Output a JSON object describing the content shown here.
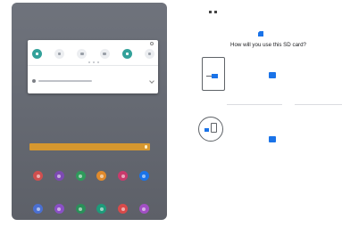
{
  "left_tablet": {
    "status_text": "",
    "quick_panel": {
      "time": "",
      "tiles": [
        {
          "name": "wifi-tile",
          "on": true
        },
        {
          "name": "sound-tile",
          "on": false
        },
        {
          "name": "rotate-tile",
          "on": false
        },
        {
          "name": "bluetooth-tile",
          "on": false
        },
        {
          "name": "lock-tile",
          "on": true
        },
        {
          "name": "airplane-tile",
          "on": false
        }
      ],
      "notification_title": "",
      "notification_text": ""
    },
    "search_label": "",
    "apps_row1": [
      "#cf4f4f",
      "#7d4ab3",
      "#2f9a5b",
      "#e08a2c",
      "#c93a6c",
      "#1a73e8"
    ],
    "apps_row2": [
      "#4a6fd1",
      "#8a4fc6",
      "#2a8f59",
      "#1d9b7a",
      "#d84a4a",
      "#a14fc4"
    ]
  },
  "setup": {
    "status_time": "",
    "title": "How will you use this SD card?",
    "option1": {
      "title": "",
      "desc": "",
      "button": ""
    },
    "or_text": "",
    "option2": {
      "title": "",
      "desc": "",
      "button": ""
    },
    "setup_later": ""
  }
}
